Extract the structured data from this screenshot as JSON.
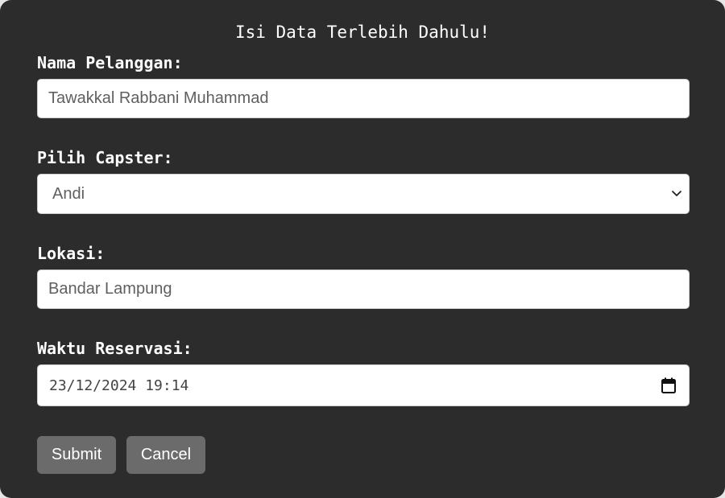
{
  "form": {
    "title": "Isi Data Terlebih Dahulu!",
    "customer_name": {
      "label": "Nama Pelanggan:",
      "value": "Tawakkal Rabbani Muhammad"
    },
    "capster": {
      "label": "Pilih Capster:",
      "selected": "Andi",
      "icon": "chevron-down-icon"
    },
    "location": {
      "label": "Lokasi:",
      "value": "Bandar Lampung"
    },
    "reservation_time": {
      "label": "Waktu Reservasi:",
      "value": "23/12/2024 19:14",
      "icon": "calendar-icon"
    },
    "buttons": {
      "submit_label": "Submit",
      "cancel_label": "Cancel"
    }
  },
  "colors": {
    "card_background": "#2c2c2c",
    "button_background": "#6b6b6b",
    "label_text": "#ffffff",
    "field_background": "#ffffff"
  }
}
